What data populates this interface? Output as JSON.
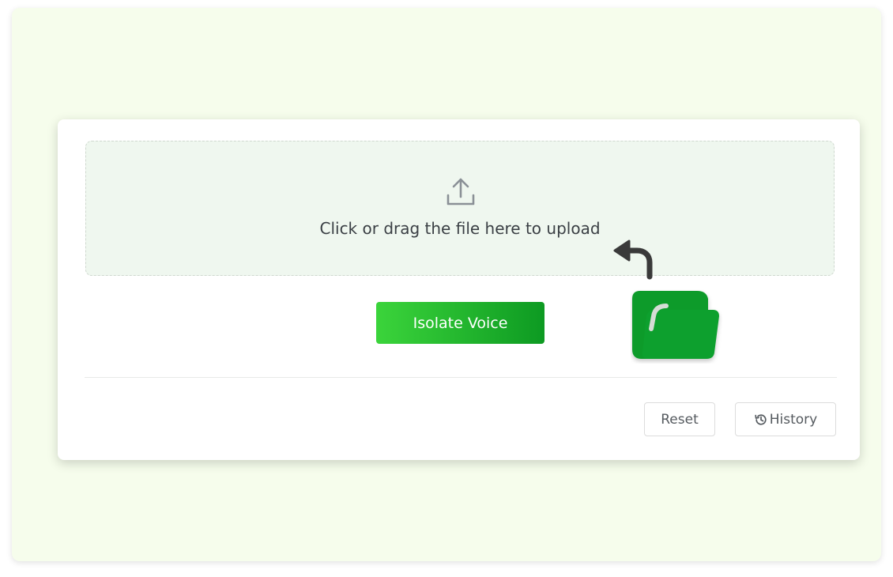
{
  "upload": {
    "text": "Click or drag the file here to upload",
    "icon": "upload-icon"
  },
  "actions": {
    "isolate_label": "Isolate Voice",
    "reset_label": "Reset",
    "history_label": "History"
  },
  "colors": {
    "panel_background": "#f6fdec",
    "dropzone_background": "#eff7ef",
    "accent_start": "#3bd43b",
    "accent_end": "#0d9a22",
    "folder_green": "#0f9b2b"
  },
  "icons": [
    "upload-icon",
    "history-icon",
    "return-arrow-icon",
    "folder-icon"
  ]
}
